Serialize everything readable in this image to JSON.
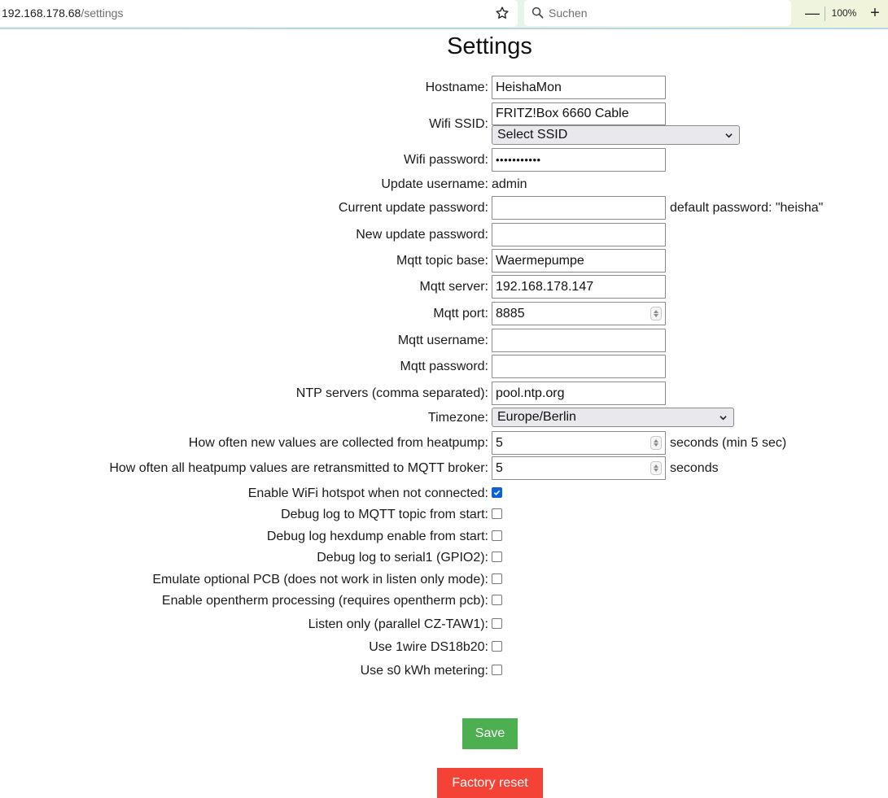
{
  "browser": {
    "url_host": "192.168.178.68",
    "url_path": "/settings",
    "search_placeholder": "Suchen",
    "zoom_minus": "—",
    "zoom_level": "100%",
    "zoom_plus": "+"
  },
  "page": {
    "title": "Settings"
  },
  "form": {
    "hostname": {
      "label": "Hostname:",
      "value": "HeishaMon"
    },
    "wifi_ssid": {
      "label": "Wifi SSID:",
      "value": "FRITZ!Box 6660 Cable",
      "select_value": "Select SSID"
    },
    "wifi_password": {
      "label": "Wifi password:",
      "value": "abcdefghijk"
    },
    "update_username": {
      "label": "Update username:",
      "value": "admin"
    },
    "current_update_password": {
      "label": "Current update password:",
      "value": "",
      "hint": "default password: \"heisha\""
    },
    "new_update_password": {
      "label": "New update password:",
      "value": ""
    },
    "mqtt_topic_base": {
      "label": "Mqtt topic base:",
      "value": "Waermepumpe"
    },
    "mqtt_server": {
      "label": "Mqtt server:",
      "value": "192.168.178.147"
    },
    "mqtt_port": {
      "label": "Mqtt port:",
      "value": "8885"
    },
    "mqtt_username": {
      "label": "Mqtt username:",
      "value": ""
    },
    "mqtt_password": {
      "label": "Mqtt password:",
      "value": ""
    },
    "ntp_servers": {
      "label": "NTP servers (comma separated):",
      "value": "pool.ntp.org"
    },
    "timezone": {
      "label": "Timezone:",
      "value": "Europe/Berlin"
    },
    "collect_interval": {
      "label": "How often new values are collected from heatpump:",
      "value": "5",
      "unit": "seconds (min 5 sec)"
    },
    "retransmit_interval": {
      "label": "How often all heatpump values are retransmitted to MQTT broker:",
      "value": "5",
      "unit": "seconds"
    },
    "checkboxes": [
      {
        "label": "Enable WiFi hotspot when not connected:",
        "checked": true
      },
      {
        "label": "Debug log to MQTT topic from start:",
        "checked": false
      },
      {
        "label": "Debug log hexdump enable from start:",
        "checked": false
      },
      {
        "label": "Debug log to serial1 (GPIO2):",
        "checked": false
      },
      {
        "label": "Emulate optional PCB (does not work in listen only mode):",
        "checked": false
      },
      {
        "label": "Enable opentherm processing (requires opentherm pcb):",
        "checked": false
      },
      {
        "label": "Listen only (parallel CZ-TAW1):",
        "checked": false
      },
      {
        "label": "Use 1wire DS18b20:",
        "checked": false
      },
      {
        "label": "Use s0 kWh metering:",
        "checked": false
      }
    ]
  },
  "buttons": {
    "save": "Save",
    "factory_reset": "Factory reset"
  },
  "colors": {
    "save": "#4caf50",
    "factory_reset": "#f44336",
    "checkbox_checked": "#0b62d6"
  }
}
